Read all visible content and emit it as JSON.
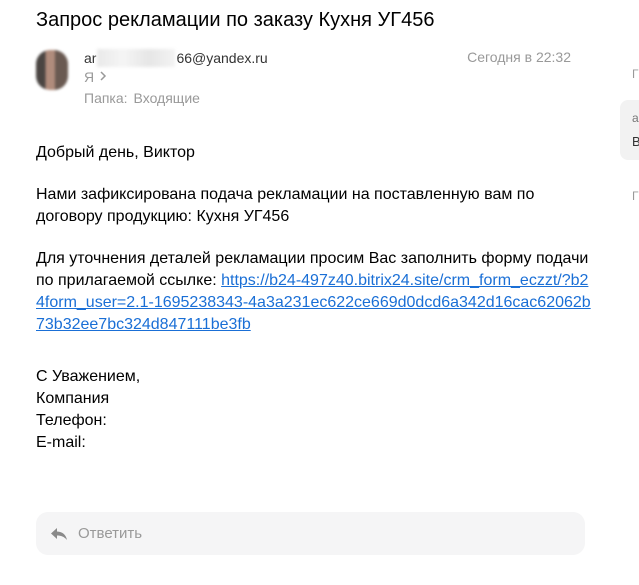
{
  "message": {
    "subject": "Запрос рекламации по заказу Кухня УГ456",
    "from_prefix": "ar",
    "from_suffix": "66@yandex.ru",
    "to": "Я",
    "date": "Сегодня в 22:32",
    "folder_label": "Папка:",
    "folder_value": "Входящие"
  },
  "body": {
    "greeting": "Добрый день, Виктор",
    "paragraph1": "Нами зафиксирована подача рекламации на поставленную вам по договору продукцию: Кухня УГ456",
    "paragraph2_text": "Для уточнения деталей рекламации просим Вас заполнить форму подачи по прилагаемой ссылке: ",
    "link": "https://b24-497z40.bitrix24.site/crm_form_eczzt/?b24form_user=2.1-1695238343-4a3a231ec622ce669d0dcd6a342d16cac62062b73b32ee7bc324d847111be3fb",
    "signature": [
      "С Уважением,",
      "Компания",
      "Телефон:",
      "E-mail:"
    ]
  },
  "reply": {
    "label": "Ответить"
  },
  "side": {
    "letter1": "Г",
    "card_line1": "а",
    "card_line2": "В",
    "letter2": "Г"
  },
  "icons": {
    "reply": "reply-arrow-icon",
    "chevron": "chevron-right-icon"
  }
}
